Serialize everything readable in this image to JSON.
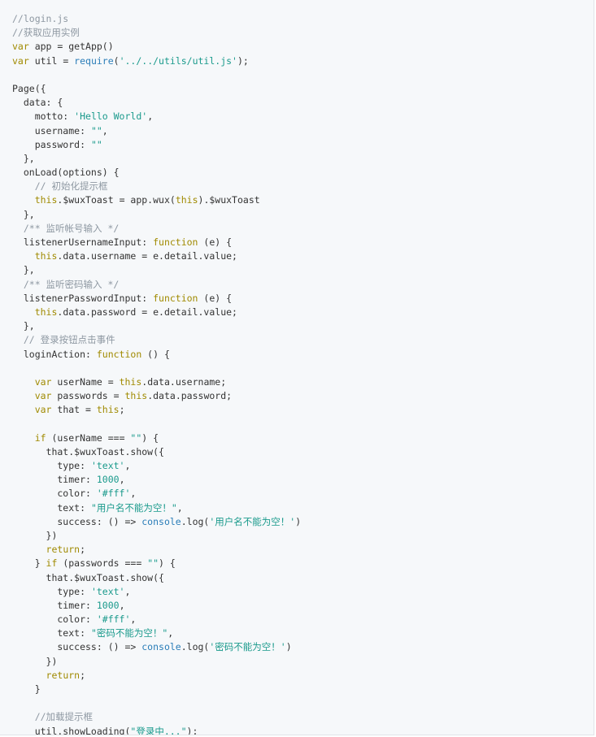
{
  "file": {
    "language": "javascript",
    "lines": [
      [
        [
          "comment",
          "//login.js"
        ]
      ],
      [
        [
          "comment",
          "//获取应用实例"
        ]
      ],
      [
        [
          "keyword",
          "var"
        ],
        [
          "plain",
          " app = getApp()"
        ]
      ],
      [
        [
          "keyword",
          "var"
        ],
        [
          "plain",
          " util = "
        ],
        [
          "builtin",
          "require"
        ],
        [
          "plain",
          "("
        ],
        [
          "string",
          "'../../utils/util.js'"
        ],
        [
          "plain",
          ");"
        ]
      ],
      [],
      [
        [
          "plain",
          "Page({"
        ]
      ],
      [
        [
          "plain",
          "  data: {"
        ]
      ],
      [
        [
          "plain",
          "    motto: "
        ],
        [
          "string",
          "'Hello World'"
        ],
        [
          "plain",
          ","
        ]
      ],
      [
        [
          "plain",
          "    username: "
        ],
        [
          "string",
          "\"\""
        ],
        [
          "plain",
          ","
        ]
      ],
      [
        [
          "plain",
          "    password: "
        ],
        [
          "string",
          "\"\""
        ]
      ],
      [
        [
          "plain",
          "  },"
        ]
      ],
      [
        [
          "plain",
          "  onLoad(options) {"
        ]
      ],
      [
        [
          "comment",
          "    // 初始化提示框"
        ]
      ],
      [
        [
          "plain",
          "    "
        ],
        [
          "keyword",
          "this"
        ],
        [
          "plain",
          ".$wuxToast = app.wux("
        ],
        [
          "keyword",
          "this"
        ],
        [
          "plain",
          ").$wuxToast"
        ]
      ],
      [
        [
          "plain",
          "  },"
        ]
      ],
      [
        [
          "comment",
          "  /** 监听帐号输入 */"
        ]
      ],
      [
        [
          "plain",
          "  listenerUsernameInput: "
        ],
        [
          "keyword",
          "function"
        ],
        [
          "plain",
          " (e) {"
        ]
      ],
      [
        [
          "plain",
          "    "
        ],
        [
          "keyword",
          "this"
        ],
        [
          "plain",
          ".data.username = e.detail.value;"
        ]
      ],
      [
        [
          "plain",
          "  },"
        ]
      ],
      [
        [
          "comment",
          "  /** 监听密码输入 */"
        ]
      ],
      [
        [
          "plain",
          "  listenerPasswordInput: "
        ],
        [
          "keyword",
          "function"
        ],
        [
          "plain",
          " (e) {"
        ]
      ],
      [
        [
          "plain",
          "    "
        ],
        [
          "keyword",
          "this"
        ],
        [
          "plain",
          ".data.password = e.detail.value;"
        ]
      ],
      [
        [
          "plain",
          "  },"
        ]
      ],
      [
        [
          "comment",
          "  // 登录按钮点击事件"
        ]
      ],
      [
        [
          "plain",
          "  loginAction: "
        ],
        [
          "keyword",
          "function"
        ],
        [
          "plain",
          " () {"
        ]
      ],
      [],
      [
        [
          "plain",
          "    "
        ],
        [
          "keyword",
          "var"
        ],
        [
          "plain",
          " userName = "
        ],
        [
          "keyword",
          "this"
        ],
        [
          "plain",
          ".data.username;"
        ]
      ],
      [
        [
          "plain",
          "    "
        ],
        [
          "keyword",
          "var"
        ],
        [
          "plain",
          " passwords = "
        ],
        [
          "keyword",
          "this"
        ],
        [
          "plain",
          ".data.password;"
        ]
      ],
      [
        [
          "plain",
          "    "
        ],
        [
          "keyword",
          "var"
        ],
        [
          "plain",
          " that = "
        ],
        [
          "keyword",
          "this"
        ],
        [
          "plain",
          ";"
        ]
      ],
      [],
      [
        [
          "plain",
          "    "
        ],
        [
          "keyword",
          "if"
        ],
        [
          "plain",
          " (userName === "
        ],
        [
          "string",
          "\"\""
        ],
        [
          "plain",
          ") {"
        ]
      ],
      [
        [
          "plain",
          "      that.$wuxToast.show({"
        ]
      ],
      [
        [
          "plain",
          "        type: "
        ],
        [
          "string",
          "'text'"
        ],
        [
          "plain",
          ","
        ]
      ],
      [
        [
          "plain",
          "        timer: "
        ],
        [
          "number",
          "1000"
        ],
        [
          "plain",
          ","
        ]
      ],
      [
        [
          "plain",
          "        color: "
        ],
        [
          "string",
          "'#fff'"
        ],
        [
          "plain",
          ","
        ]
      ],
      [
        [
          "plain",
          "        text: "
        ],
        [
          "string",
          "\"用户名不能为空！\""
        ],
        [
          "plain",
          ","
        ]
      ],
      [
        [
          "plain",
          "        success: () => "
        ],
        [
          "builtin",
          "console"
        ],
        [
          "plain",
          ".log("
        ],
        [
          "string",
          "'用户名不能为空！'"
        ],
        [
          "plain",
          ")"
        ]
      ],
      [
        [
          "plain",
          "      })"
        ]
      ],
      [
        [
          "plain",
          "      "
        ],
        [
          "keyword",
          "return"
        ],
        [
          "plain",
          ";"
        ]
      ],
      [
        [
          "plain",
          "    } "
        ],
        [
          "keyword",
          "if"
        ],
        [
          "plain",
          " (passwords === "
        ],
        [
          "string",
          "\"\""
        ],
        [
          "plain",
          ") {"
        ]
      ],
      [
        [
          "plain",
          "      that.$wuxToast.show({"
        ]
      ],
      [
        [
          "plain",
          "        type: "
        ],
        [
          "string",
          "'text'"
        ],
        [
          "plain",
          ","
        ]
      ],
      [
        [
          "plain",
          "        timer: "
        ],
        [
          "number",
          "1000"
        ],
        [
          "plain",
          ","
        ]
      ],
      [
        [
          "plain",
          "        color: "
        ],
        [
          "string",
          "'#fff'"
        ],
        [
          "plain",
          ","
        ]
      ],
      [
        [
          "plain",
          "        text: "
        ],
        [
          "string",
          "\"密码不能为空！\""
        ],
        [
          "plain",
          ","
        ]
      ],
      [
        [
          "plain",
          "        success: () => "
        ],
        [
          "builtin",
          "console"
        ],
        [
          "plain",
          ".log("
        ],
        [
          "string",
          "'密码不能为空！'"
        ],
        [
          "plain",
          ")"
        ]
      ],
      [
        [
          "plain",
          "      })"
        ]
      ],
      [
        [
          "plain",
          "      "
        ],
        [
          "keyword",
          "return"
        ],
        [
          "plain",
          ";"
        ]
      ],
      [
        [
          "plain",
          "    }"
        ]
      ],
      [],
      [
        [
          "comment",
          "    //加载提示框"
        ]
      ],
      [
        [
          "plain",
          "    util.showLoading("
        ],
        [
          "string",
          "\"登录中...\""
        ],
        [
          "plain",
          ");"
        ]
      ]
    ]
  },
  "colors": {
    "background": "#f6f8fa",
    "border": "#e1e4e8",
    "plain": "#333333",
    "comment": "#8e98a2",
    "keyword": "#a08a00",
    "string": "#1a9a8c",
    "builtin": "#2a7db8"
  }
}
